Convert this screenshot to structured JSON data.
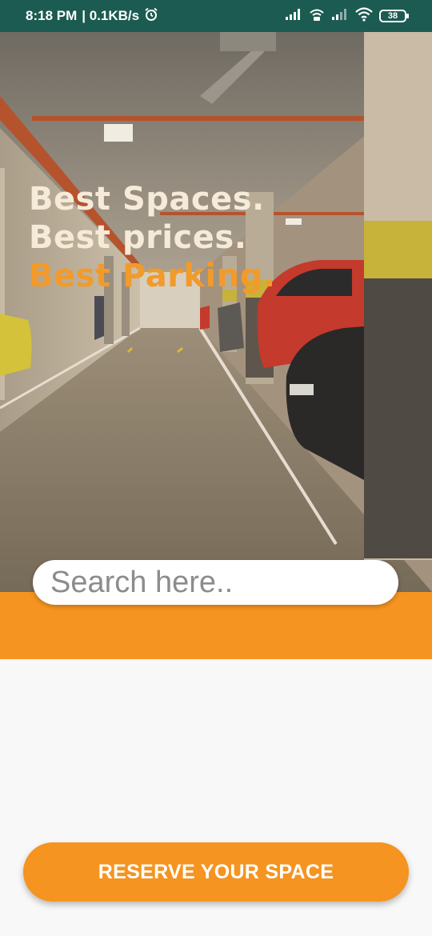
{
  "status_bar": {
    "time": "8:18 PM",
    "network_speed": "| 0.1KB/s",
    "battery_level": "38",
    "icons": [
      "alarm-icon",
      "signal-icon",
      "hd-wifi-calling-icon",
      "signal-icon",
      "wifi-icon",
      "battery-icon"
    ]
  },
  "hero": {
    "headline_line1": "Best Spaces.",
    "headline_line2": "Best prices.",
    "headline_line3": "Best Parking.",
    "accent_color": "#f29a2a"
  },
  "search": {
    "placeholder": "Search here..",
    "value": "",
    "icon": "search-icon"
  },
  "actions": {
    "reserve_label": "RESERVE YOUR SPACE"
  },
  "colors": {
    "brand_orange": "#f59420",
    "status_bar": "#1c5b52"
  }
}
